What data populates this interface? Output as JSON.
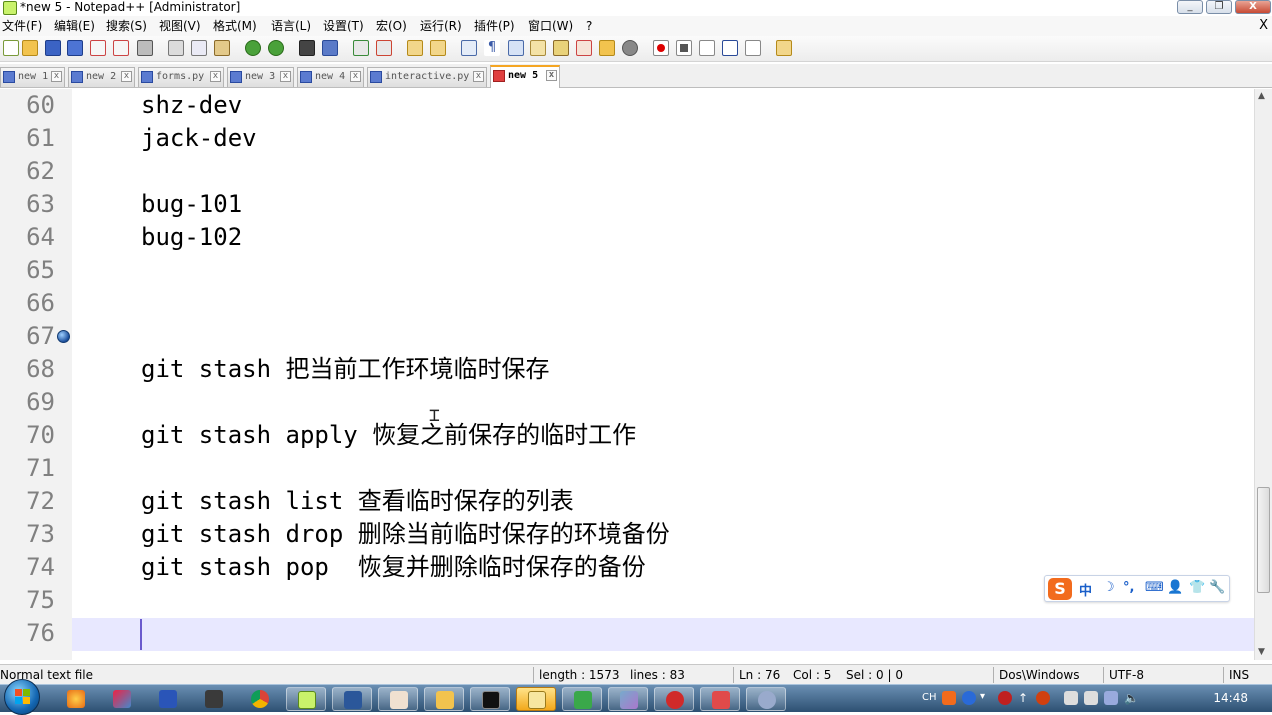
{
  "window": {
    "title": "*new 5 - Notepad++ [Administrator]",
    "controls": [
      "_",
      "❐",
      "X"
    ]
  },
  "menu": {
    "items": [
      "文件(F)",
      "编辑(E)",
      "搜索(S)",
      "视图(V)",
      "格式(M)",
      "语言(L)",
      "设置(T)",
      "宏(O)",
      "运行(R)",
      "插件(P)",
      "窗口(W)",
      "?"
    ],
    "close": "X"
  },
  "tabs": [
    {
      "label": "new 1",
      "close": "x",
      "active": false
    },
    {
      "label": "new 2",
      "close": "x",
      "active": false
    },
    {
      "label": "forms.py",
      "close": "x",
      "active": false
    },
    {
      "label": "new 3",
      "close": "x",
      "active": false
    },
    {
      "label": "new 4",
      "close": "x",
      "active": false
    },
    {
      "label": "interactive.py",
      "close": "x",
      "active": false
    },
    {
      "label": "new 5",
      "close": "x",
      "active": true
    }
  ],
  "editor": {
    "lines": [
      {
        "num": "60",
        "text": "shz-dev"
      },
      {
        "num": "61",
        "text": "jack-dev"
      },
      {
        "num": "62",
        "text": ""
      },
      {
        "num": "63",
        "text": "bug-101"
      },
      {
        "num": "64",
        "text": "bug-102"
      },
      {
        "num": "65",
        "text": ""
      },
      {
        "num": "66",
        "text": ""
      },
      {
        "num": "67",
        "text": ""
      },
      {
        "num": "68",
        "text": "git stash 把当前工作环境临时保存"
      },
      {
        "num": "69",
        "text": ""
      },
      {
        "num": "70",
        "text": "git stash apply 恢复之前保存的临时工作"
      },
      {
        "num": "71",
        "text": ""
      },
      {
        "num": "72",
        "text": "git stash list 查看临时保存的列表"
      },
      {
        "num": "73",
        "text": "git stash drop 删除当前临时保存的环境备份"
      },
      {
        "num": "74",
        "text": "git stash pop  恢复并删除临时保存的备份"
      },
      {
        "num": "75",
        "text": ""
      },
      {
        "num": "76",
        "text": ""
      }
    ],
    "bookmark_line": "67",
    "current_line": "76"
  },
  "ime": {
    "logo": "S",
    "items": [
      "中",
      "☽",
      "°,",
      "⌨",
      "👤",
      "👕",
      "🔧"
    ]
  },
  "status": {
    "file_type": "Normal text file",
    "length": "length : 1573",
    "lines": "lines : 83",
    "ln": "Ln : 76",
    "col": "Col : 5",
    "sel": "Sel : 0 | 0",
    "eol": "Dos\\Windows",
    "encoding": "UTF-8",
    "mode": "INS"
  },
  "taskbar": {
    "tray_lang": "CH",
    "clock": "14:48"
  },
  "colors": {
    "current_line_bg": "#e8e8ff",
    "gutter_bg": "#f2f2f2",
    "line_number": "#808080",
    "active_tab_accent": "#f5a623",
    "ime_brand": "#f26b1d"
  }
}
